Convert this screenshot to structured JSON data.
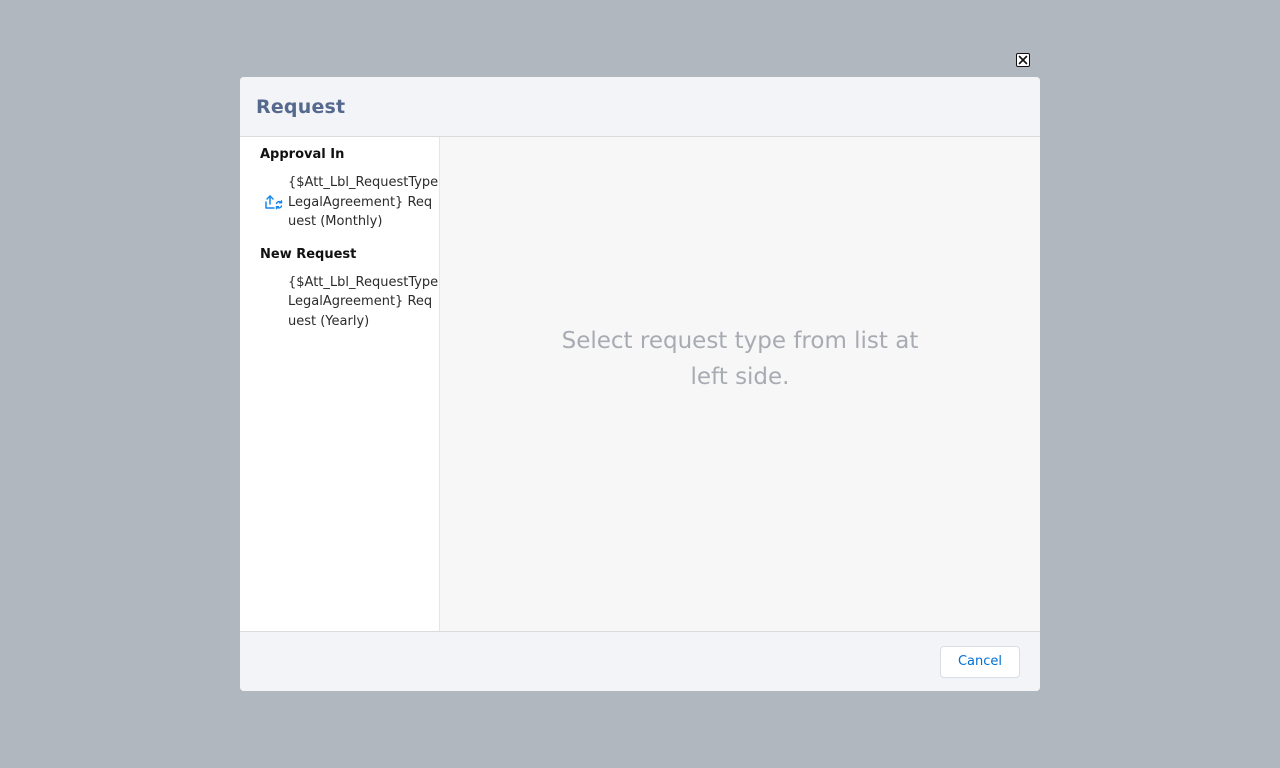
{
  "dialog": {
    "title": "Request",
    "close_icon": "close-icon"
  },
  "sidebar": {
    "groups": [
      {
        "label": "Approval In",
        "items": [
          {
            "label": "{$Att_Lbl_RequestTypeLegalAgreement} Request (Monthly)",
            "icon": "upload-refresh-icon"
          }
        ]
      },
      {
        "label": "New Request",
        "items": [
          {
            "label": "{$Att_Lbl_RequestTypeLegalAgreement} Request (Yearly)",
            "icon": ""
          }
        ]
      }
    ]
  },
  "content": {
    "empty_message": "Select request type from list at left side."
  },
  "footer": {
    "cancel_label": "Cancel"
  },
  "colors": {
    "overlay": "#b0b7bf",
    "title": "#54698d",
    "accent": "#0070d2",
    "placeholder_text": "#a8acb2"
  }
}
